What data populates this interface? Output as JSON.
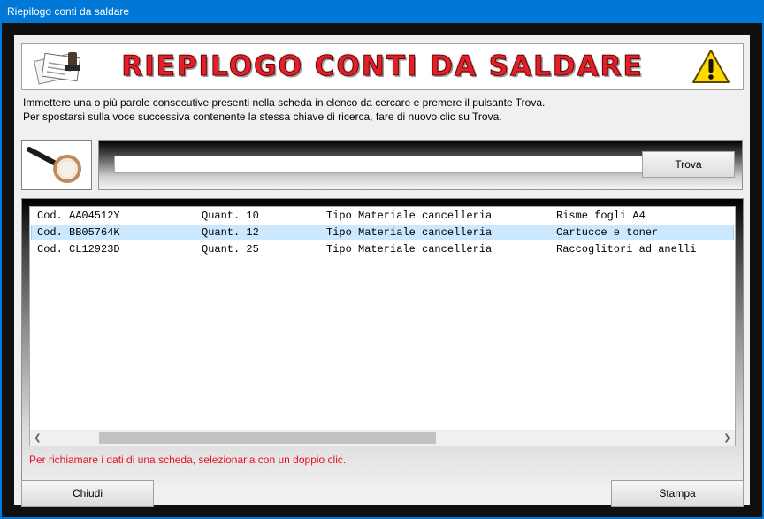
{
  "window": {
    "title": "Riepilogo conti da saldare"
  },
  "banner": {
    "title": "RIEPILOGO CONTI DA SALDARE"
  },
  "instructions": {
    "line1": "Immettere una o più parole consecutive presenti nella scheda in elenco da cercare e premere il pulsante Trova.",
    "line2": "Per spostarsi sulla voce successiva contenente la stessa chiave di ricerca, fare di nuovo clic su Trova."
  },
  "search": {
    "value": "",
    "button_label": "Trova"
  },
  "list": {
    "rows": [
      {
        "code": "Cod. AA04512Y",
        "qty": "Quant. 10",
        "type": "Tipo Materiale cancelleria",
        "desc": "Risme fogli A4",
        "selected": false
      },
      {
        "code": "Cod. BB05764K",
        "qty": "Quant. 12",
        "type": "Tipo Materiale cancelleria",
        "desc": "Cartucce e toner",
        "selected": true
      },
      {
        "code": "Cod. CL12923D",
        "qty": "Quant. 25",
        "type": "Tipo Materiale cancelleria",
        "desc": "Raccoglitori ad anelli",
        "selected": false
      }
    ],
    "hint": "Per richiamare i dati di una scheda, selezionarla con un doppio clic."
  },
  "footer": {
    "close_label": "Chiudi",
    "print_label": "Stampa"
  },
  "colors": {
    "titlebar": "#0078d7",
    "selection": "#cce8ff",
    "banner_text": "#e2202a",
    "hint_text": "#e81123"
  },
  "icons": {
    "banner_left": "stamp-documents-icon",
    "banner_right": "warning-icon",
    "search": "magnifier-icon"
  }
}
